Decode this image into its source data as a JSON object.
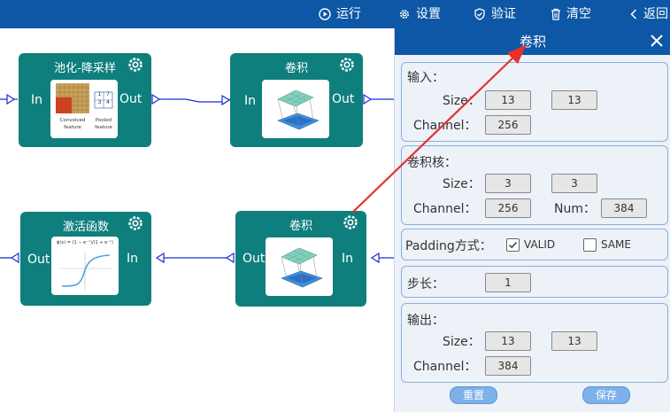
{
  "toolbar": {
    "run_label": "运行",
    "settings_label": "设置",
    "validate_label": "验证",
    "clear_label": "清空",
    "back_label": "返回"
  },
  "nodes": [
    {
      "title": "池化-降采样",
      "in": "In",
      "out": "Out",
      "caption_left": "Convolved feature",
      "caption_right": "Pooled feature",
      "digits": [
        "1",
        "7",
        "3",
        "4"
      ]
    },
    {
      "title": "卷积",
      "in": "In",
      "out": "Out"
    },
    {
      "title": "激活函数",
      "in": "In",
      "out": "Out",
      "formula": "ϕ(x) = (1 − e⁻ˣ)/(1 + e⁻ˣ)"
    },
    {
      "title": "卷积",
      "in": "In",
      "out": "Out"
    }
  ],
  "panel": {
    "title": "卷积",
    "input": {
      "heading": "输入：",
      "size_label": "Size：",
      "size_w": "13",
      "size_h": "13",
      "channel_label": "Channel：",
      "channel": "256"
    },
    "kernel": {
      "heading": "卷积核：",
      "size_label": "Size：",
      "size_w": "3",
      "size_h": "3",
      "channel_label": "Channel：",
      "channel": "256",
      "num_label": "Num：",
      "num": "384"
    },
    "padding": {
      "label": "Padding方式：",
      "options": [
        {
          "label": "VALID",
          "checked": true
        },
        {
          "label": "SAME",
          "checked": false
        }
      ]
    },
    "stride": {
      "label": "步长：",
      "value": "1"
    },
    "output": {
      "heading": "输出：",
      "size_label": "Size：",
      "size_w": "13",
      "size_h": "13",
      "channel_label": "Channel：",
      "channel": "384"
    },
    "reset_label": "重置",
    "save_label": "保存"
  },
  "colors": {
    "accent": "#0d57a6",
    "node": "#0e7f7d",
    "connector": "#1a2fd6",
    "arrow": "#e8302a"
  }
}
